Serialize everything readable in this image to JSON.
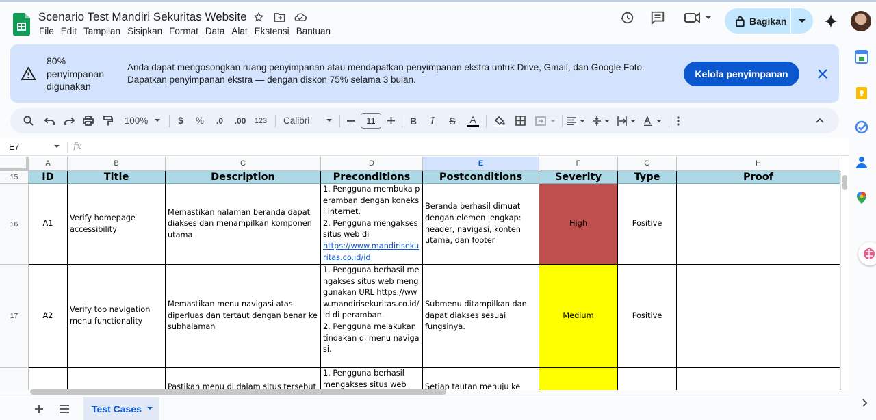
{
  "document": {
    "title": "Scenario Test Mandiri Sekuritas Website",
    "menu": [
      "File",
      "Edit",
      "Tampilan",
      "Sisipkan",
      "Format",
      "Data",
      "Alat",
      "Ekstensi",
      "Bantuan"
    ],
    "share_label": "Bagikan"
  },
  "banner": {
    "percent_label": "80% penyimpanan digunakan",
    "message": "Anda dapat mengosongkan ruang penyimpanan atau mendapatkan penyimpanan ekstra untuk Drive, Gmail, dan Google Foto. Dapatkan penyimpanan ekstra — dengan diskon 75% selama 3 bulan.",
    "button_label": "Kelola penyimpanan"
  },
  "toolbar": {
    "zoom": "100%",
    "currency": "$",
    "percent": "%",
    "dec_decrease": ".0",
    "dec_increase": ".00",
    "number_format": "123",
    "font": "Calibri",
    "font_size": "11",
    "bold": "B",
    "italic": "I",
    "strike": "S",
    "text_color": "A"
  },
  "formula_bar": {
    "cell_ref": "E7",
    "fx": "fx",
    "value": ""
  },
  "columns": [
    "A",
    "B",
    "C",
    "D",
    "E",
    "F",
    "G",
    "H"
  ],
  "selected_column": "E",
  "rows": {
    "header_row_number": "15",
    "headers": [
      "ID",
      "Title",
      "Description",
      "Preconditions",
      "Postconditions",
      "Severity",
      "Type",
      "Proof"
    ],
    "data": [
      {
        "row_number": "16",
        "id": "A1",
        "title": "Verify homepage accessibility",
        "description": "Memastikan halaman beranda dapat diakses dan menampilkan komponen utama",
        "preconditions_text": "1. Pengguna membuka peramban dengan koneksi internet.\n2. Pengguna mengakses situs web di",
        "preconditions_link": "https://www.mandirisekuritas.co.id/id",
        "postconditions": "Beranda berhasil dimuat dengan elemen lengkap: header, navigasi, konten utama, dan footer",
        "severity": "High",
        "severity_color": "#c0504d",
        "type": "Positive",
        "proof": ""
      },
      {
        "row_number": "17",
        "id": "A2",
        "title": "Verify top navigation menu functionality",
        "description": "Memastikan menu navigasi atas diperluas dan tertaut dengan benar ke subhalaman",
        "preconditions_text": "1. Pengguna berhasil mengakses situs web menggunakan URL https://www.mandirisekuritas.co.id/id di peramban.\n2. Pengguna melakukan tindakan di menu navigasi.",
        "preconditions_link": "",
        "postconditions": "Submenu ditampilkan dan dapat diakses sesuai fungsinya.",
        "severity": "Medium",
        "severity_color": "#ffff00",
        "type": "Positive",
        "proof": ""
      },
      {
        "row_number": "",
        "id": "",
        "title": "",
        "description": "Pastikan menu di dalam situs tersebut",
        "preconditions_text": "1. Pengguna berhasil mengakses situs web",
        "preconditions_link": "",
        "postconditions": "Setiap tautan menuju ke halaman",
        "severity": "",
        "severity_color": "#ffff00",
        "type": "",
        "proof": ""
      }
    ]
  },
  "sheet_tab": "Test Cases"
}
